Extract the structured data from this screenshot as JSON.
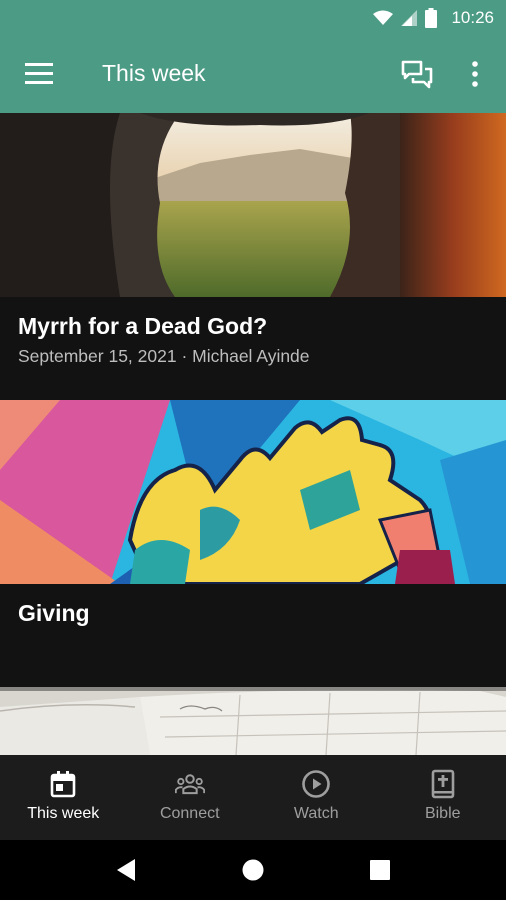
{
  "status_bar": {
    "time": "10:26"
  },
  "app_bar": {
    "title": "This week"
  },
  "feed": [
    {
      "title": "Myrrh for a Dead God?",
      "meta": "September 15, 2021 · Michael Ayinde"
    },
    {
      "title": "Giving",
      "meta": ""
    }
  ],
  "bottom_nav": [
    {
      "label": "This week",
      "icon": "calendar-icon",
      "active": true
    },
    {
      "label": "Connect",
      "icon": "people-icon",
      "active": false
    },
    {
      "label": "Watch",
      "icon": "play-circle-icon",
      "active": false
    },
    {
      "label": "Bible",
      "icon": "bible-icon",
      "active": false
    }
  ],
  "colors": {
    "accent": "#4c9b84",
    "background": "#121212",
    "nav_bg": "#1c1c1c"
  }
}
